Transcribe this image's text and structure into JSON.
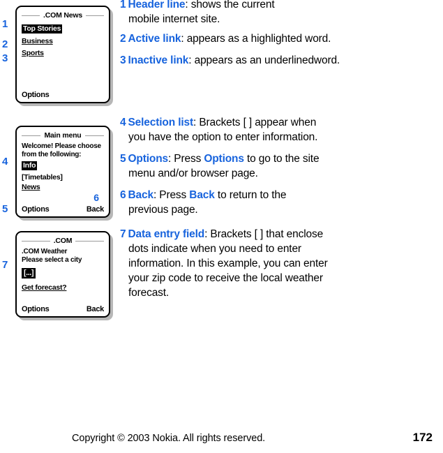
{
  "page": {
    "footer_copyright": "Copyright © 2003 Nokia. All rights reserved.",
    "page_number": "172",
    "accent_color": "#1763dd",
    "text_color": "#000000",
    "background_color": "#ffffff"
  },
  "callouts": {
    "n1": "1",
    "n2": "2",
    "n3": "3",
    "n4": "4",
    "n5": "5",
    "n6": "6",
    "n7": "7"
  },
  "screens": [
    {
      "id": "news-screen",
      "header": ".COM News",
      "items": [
        {
          "label": "Top Stories",
          "style": "highlighted"
        },
        {
          "label": "Business",
          "style": "underlined"
        },
        {
          "label": "Sports",
          "style": "underlined"
        }
      ],
      "softkey_left": "Options",
      "softkey_right": ""
    },
    {
      "id": "main-menu-screen",
      "header": "Main menu",
      "text_line_1": "Welcome! Please choose",
      "text_line_2": "from the following:",
      "items": [
        {
          "label": "Info",
          "style": "highlighted"
        },
        {
          "label": "[Timetables]",
          "style": "plain"
        },
        {
          "label": "News",
          "style": "underlined"
        }
      ],
      "softkey_left": "Options",
      "softkey_right": "Back"
    },
    {
      "id": "weather-screen",
      "header": ".COM",
      "text_line_1": ".COM Weather",
      "text_line_2": "Please select a city",
      "entry_field": "[...]",
      "link": "Get forecast?",
      "softkey_left": "Options",
      "softkey_right": "Back"
    }
  ],
  "notes": [
    {
      "index": "1",
      "term": "Header line",
      "body_line_1": ": shows the current",
      "body_line_2": "mobile internet site."
    },
    {
      "index": "2",
      "term": "Active link",
      "body_line_1": ": appears as a highlighted word."
    },
    {
      "index": "3",
      "term": "Inactive link",
      "body_line_1": ": appears as an underlinedword."
    },
    {
      "index": "4",
      "term": "Selection list",
      "body_line_1": ": Brackets [ ] appear when",
      "body_line_2": "you have the option to enter information."
    },
    {
      "index": "5",
      "term": "Options",
      "body_a": ": Press ",
      "keyword": "Options",
      "body_b": " to go to the site",
      "body_line_2": "menu and/or browser page."
    },
    {
      "index": "6",
      "term": "Back",
      "body_a": ": Press ",
      "keyword": "Back",
      "body_b": " to return to the",
      "body_line_2": "previous page."
    },
    {
      "index": "7",
      "term": "Data entry field",
      "body_line_1": ": Brackets [ ] that enclose",
      "body_line_2": "dots indicate when you need to enter",
      "body_line_3": "information. In this example, you can enter",
      "body_line_4": "your zip code to receive the local weather",
      "body_line_5": "forecast."
    }
  ]
}
